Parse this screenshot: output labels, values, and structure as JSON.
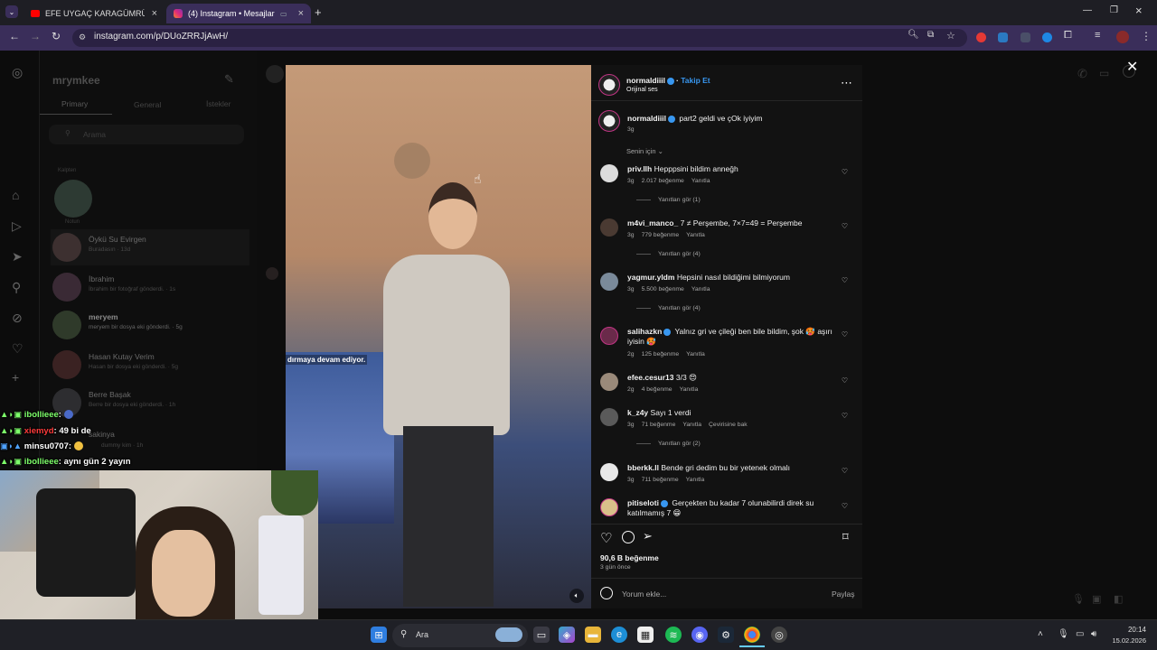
{
  "browser": {
    "tabs": [
      {
        "label": "EFE UYGAÇ KARAGÜMRÜK YAN",
        "icon": "youtube-icon"
      },
      {
        "label": "(4) Instagram • Mesajlar",
        "icon": "instagram-icon"
      }
    ],
    "url": "instagram.com/p/DUoZRRJjAwH/",
    "new_tab_label": "+"
  },
  "dm_panel": {
    "username": "mrymkee",
    "tabs": [
      "Primary",
      "General",
      "İstekler"
    ],
    "search_placeholder": "Arama",
    "note_label": "Kalpten",
    "note_owner": "Notun",
    "conversations": [
      {
        "name": "Öykü Su Evirgen",
        "sub": "Buradasın · 13d"
      },
      {
        "name": "İbrahim",
        "sub": "İbrahim bir fotoğraf gönderdi. · 1s"
      },
      {
        "name": "meryem",
        "sub": "meryem bir dosya eki gönderdi. · 5g"
      },
      {
        "name": "Hasan Kutay Verim",
        "sub": "Hasan bir dosya eki gönderdi. · 5g"
      },
      {
        "name": "Berre Başak",
        "sub": "Berre bir dosya eki gönderdi. · 1h"
      },
      {
        "name": "sakinya",
        "sub": "dummy kim · 1h"
      }
    ]
  },
  "video": {
    "caption": "dırmaya devam ediyor."
  },
  "post": {
    "author": "normaldiiil",
    "follow_label": "Takip Et",
    "audio": "Orijinal ses",
    "caption_author": "normaldiiil",
    "caption": "part2 geldi ve çOk iyiyim",
    "caption_time": "3g",
    "sort_label": "Senin için",
    "comments": [
      {
        "user": "priv.llh",
        "text": "Hepppsini bildim anneğh",
        "time": "3g",
        "likes": "2.017 beğenme",
        "reply": "Yanıtla",
        "replies": "Yanıtları gör (1)"
      },
      {
        "user": "m4vi_manco_",
        "text": "7 ≠ Perşembe, 7×7=49 = Perşembe",
        "time": "3g",
        "likes": "779 beğenme",
        "reply": "Yanıtla",
        "replies": "Yanıtları gör (4)"
      },
      {
        "user": "yagmur.yldm",
        "text": "Hepsini nasıl bildiğimi bilmiyorum",
        "time": "3g",
        "likes": "5.500 beğenme",
        "reply": "Yanıtla",
        "replies": "Yanıtları gör (4)"
      },
      {
        "user": "salihazkn",
        "text": "Yalnız gri ve çileği ben bile bildim, şok 🥵 aşırı iyisin 🥵",
        "time": "2g",
        "likes": "125 beğenme",
        "reply": "Yanıtla",
        "replies": ""
      },
      {
        "user": "efee.cesur13",
        "text": "3/3 😍",
        "time": "2g",
        "likes": "4 beğenme",
        "reply": "Yanıtla",
        "replies": ""
      },
      {
        "user": "k_z4y",
        "text": "Sayı 1 verdi",
        "time": "3g",
        "likes": "71 beğenme",
        "reply": "Yanıtla",
        "translate": "Çevirisine bak",
        "replies": "Yanıtları gör (2)"
      },
      {
        "user": "bberkk.ll",
        "text": "Bende gri dedim bu bir yetenek olmalı",
        "time": "3g",
        "likes": "711 beğenme",
        "reply": "Yanıtla",
        "replies": ""
      },
      {
        "user": "pitiseloti",
        "text": "Gerçekten bu kadar 7 olunabilirdi direk su katılmamış 7 😁",
        "time": "",
        "likes": "",
        "reply": "",
        "replies": ""
      }
    ],
    "likes_total": "90,6 B beğenme",
    "posted_ago": "3 gün önce",
    "comment_placeholder": "Yorum ekle...",
    "share_label": "Paylaş"
  },
  "chat": [
    {
      "user": "ibollieee",
      "message": ":",
      "color": "#7dff6a"
    },
    {
      "user": "xiemyd",
      "message": ": 49 bi de",
      "color": "#ff3b3b"
    },
    {
      "user": "minsu0707",
      "message": ":",
      "color": "#ffffff"
    },
    {
      "user": "ibollieee",
      "message": ": aynı gün 2 yayın",
      "color": "#7dff6a"
    }
  ],
  "taskbar": {
    "search_label": "Ara",
    "time": "20:14",
    "date": "15.02.2026"
  },
  "colors": {
    "accent_blue": "#3897f0",
    "browser_purple": "#3a2e5a"
  }
}
